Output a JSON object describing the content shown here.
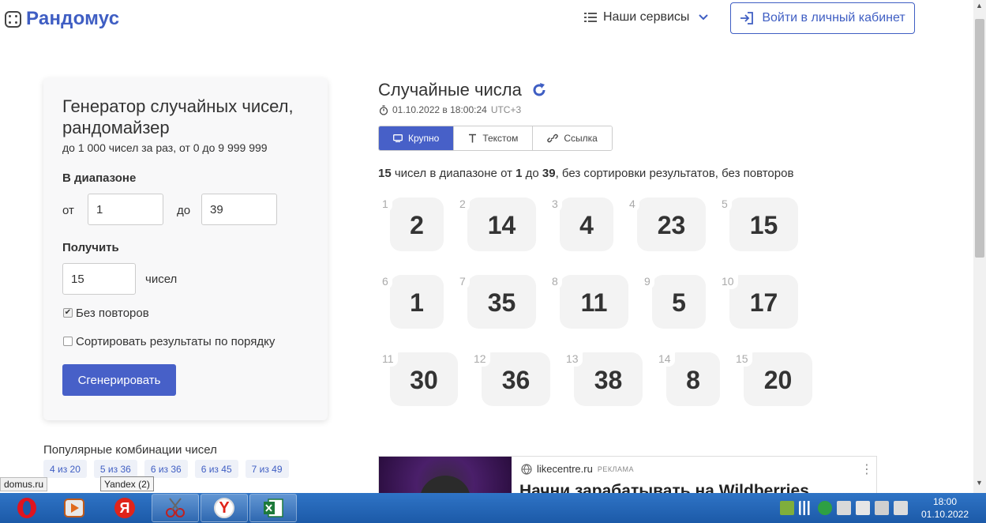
{
  "header": {
    "logo_text": "Рандомус",
    "services_label": "Наши сервисы",
    "login_label": "Войти в личный кабинет"
  },
  "form": {
    "title": "Генератор случайных чисел, рандомайзер",
    "subtitle": "до 1 000 чисел за раз, от 0 до 9 999 999",
    "range_label": "В диапазоне",
    "from_label": "от",
    "from_value": "1",
    "to_label": "до",
    "to_value": "39",
    "count_label": "Получить",
    "count_value": "15",
    "count_unit": "чисел",
    "no_repeat_label": "Без повторов",
    "no_repeat_checked": true,
    "sort_label": "Сортировать результаты по порядку",
    "sort_checked": false,
    "generate_label": "Сгенерировать"
  },
  "popular": {
    "title": "Популярные комбинации чисел",
    "chips": [
      "4 из 20",
      "5 из 36",
      "6 из 36",
      "6 из 45",
      "7 из 49"
    ]
  },
  "results": {
    "title": "Случайные числа",
    "timestamp": "01.10.2022 в 18:00:24",
    "timezone": "UTC+3",
    "tabs": [
      "Крупно",
      "Текстом",
      "Ссылка"
    ],
    "active_tab": 0,
    "summary": {
      "count": "15",
      "part1": " чисел в диапазоне от ",
      "from": "1",
      "part2": " до ",
      "to": "39",
      "part3": ", без сортировки результатов, без повторов"
    },
    "numbers": [
      {
        "index": "1",
        "value": "2"
      },
      {
        "index": "2",
        "value": "14"
      },
      {
        "index": "3",
        "value": "4"
      },
      {
        "index": "4",
        "value": "23"
      },
      {
        "index": "5",
        "value": "15"
      },
      {
        "index": "6",
        "value": "1"
      },
      {
        "index": "7",
        "value": "35"
      },
      {
        "index": "8",
        "value": "11"
      },
      {
        "index": "9",
        "value": "5"
      },
      {
        "index": "10",
        "value": "17"
      },
      {
        "index": "11",
        "value": "30"
      },
      {
        "index": "12",
        "value": "36"
      },
      {
        "index": "13",
        "value": "38"
      },
      {
        "index": "14",
        "value": "8"
      },
      {
        "index": "15",
        "value": "20"
      }
    ]
  },
  "ad": {
    "source": "likecentre.ru",
    "tag": "РЕКЛАМА",
    "headline": "Начни зарабатывать на Wildberries"
  },
  "overlay": {
    "status_url": "domus.ru",
    "tooltip": "Yandex (2)"
  },
  "taskbar": {
    "time": "18:00",
    "date": "01.10.2022"
  },
  "colors": {
    "accent": "#3f5ec3",
    "button": "#4760c8",
    "taskbar": "#1c5aa8"
  }
}
